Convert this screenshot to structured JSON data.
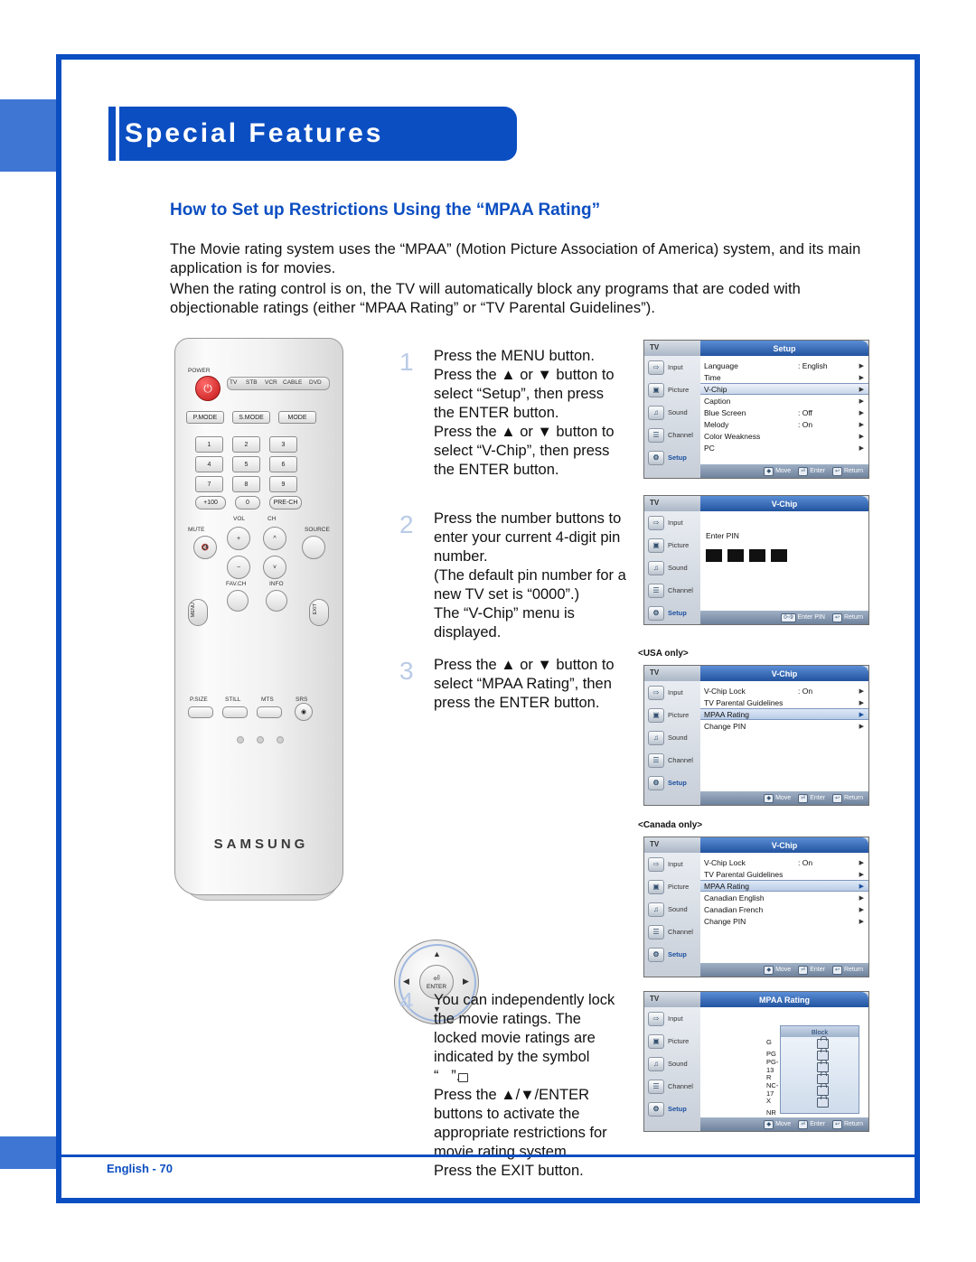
{
  "page": {
    "header_title": "Special Features",
    "section_title": "How to Set up Restrictions Using the “MPAA Rating”",
    "paragraph_1": "The Movie rating system uses the “MPAA” (Motion Picture Association of America) system, and its main application is for movies.",
    "paragraph_2": "When the rating control is on, the TV will automatically block any programs that are coded with objectionable ratings (either “MPAA Rating” or “TV Parental Guidelines”).",
    "footer": "English - 70"
  },
  "steps": [
    {
      "num": "1",
      "text": "Press the MENU button.\nPress the ▲ or ▼ button to select “Setup”, then press the ENTER button.\nPress the ▲ or ▼ button to select “V-Chip”, then press the ENTER button."
    },
    {
      "num": "2",
      "text": "Press the number buttons to enter your current 4-digit pin number.\n(The default pin number for a new TV set is “0000”.)\nThe “V-Chip” menu is displayed."
    },
    {
      "num": "3",
      "text": "Press the ▲ or ▼ button to select “MPAA Rating”, then press the ENTER button."
    },
    {
      "num": "4",
      "text": "You can independently lock the movie ratings. The locked movie ratings are indicated by the symbol\n“   ”.\nPress the ▲/▼/ENTER buttons to activate the appropriate restrictions for movie rating system.\nPress the EXIT button."
    }
  ],
  "remote": {
    "power_label": "POWER",
    "source_buttons": [
      "TV",
      "STB",
      "VCR",
      "CABLE",
      "DVD"
    ],
    "mode_row": [
      "P.MODE",
      "S.MODE",
      "MODE"
    ],
    "numbers": [
      "1",
      "2",
      "3",
      "4",
      "5",
      "6",
      "7",
      "8",
      "9"
    ],
    "num_row4": [
      "+100",
      "0",
      "PRE-CH"
    ],
    "vol_label": "VOL",
    "ch_label": "CH",
    "mute_label": "MUTE",
    "source_label": "SOURCE",
    "fav_label": "FAV.CH",
    "info_label": "INFO",
    "menu_label": "MENU",
    "exit_label": "EXIT",
    "enter_label": "ENTER",
    "bottom_row": [
      "P.SIZE",
      "STILL",
      "MTS",
      "SRS"
    ],
    "brand": "SAMSUNG"
  },
  "osd_common": {
    "tv_label": "TV",
    "side_items": [
      "Input",
      "Picture",
      "Sound",
      "Channel",
      "Setup"
    ],
    "footer": {
      "move": "Move",
      "enter": "Enter",
      "return": "Return"
    }
  },
  "osd_setup": {
    "title": "Setup",
    "rows": [
      {
        "label": "Language",
        "value": ": English",
        "chev": "▶",
        "selected": false
      },
      {
        "label": "Time",
        "value": "",
        "chev": "▶",
        "selected": false
      },
      {
        "label": "V-Chip",
        "value": "",
        "chev": "▶",
        "selected": true
      },
      {
        "label": "Caption",
        "value": "",
        "chev": "▶",
        "selected": false
      },
      {
        "label": "Blue Screen",
        "value": ": Off",
        "chev": "▶",
        "selected": false
      },
      {
        "label": "Melody",
        "value": ": On",
        "chev": "▶",
        "selected": false
      },
      {
        "label": "Color Weakness",
        "value": "",
        "chev": "▶",
        "selected": false
      },
      {
        "label": "PC",
        "value": "",
        "chev": "▶",
        "selected": false
      }
    ]
  },
  "osd_pin": {
    "title": "V-Chip",
    "prompt": "Enter PIN",
    "footer_enter": "Enter PIN",
    "footer_return": "Return",
    "digits": 4
  },
  "osd_usa": {
    "caption": "<USA only>",
    "title": "V-Chip",
    "rows": [
      {
        "label": "V-Chip Lock",
        "value": ": On",
        "chev": "▶",
        "selected": false
      },
      {
        "label": "TV Parental Guidelines",
        "value": "",
        "chev": "▶",
        "selected": false
      },
      {
        "label": "MPAA Rating",
        "value": "",
        "chev": "▶",
        "selected": true
      },
      {
        "label": "Change PIN",
        "value": "",
        "chev": "▶",
        "selected": false
      }
    ]
  },
  "osd_canada": {
    "caption": "<Canada only>",
    "title": "V-Chip",
    "rows": [
      {
        "label": "V-Chip Lock",
        "value": ": On",
        "chev": "▶",
        "selected": false
      },
      {
        "label": "TV Parental Guidelines",
        "value": "",
        "chev": "▶",
        "selected": false
      },
      {
        "label": "MPAA Rating",
        "value": "",
        "chev": "▶",
        "selected": true
      },
      {
        "label": "Canadian English",
        "value": "",
        "chev": "▶",
        "selected": false
      },
      {
        "label": "Canadian French",
        "value": "",
        "chev": "▶",
        "selected": false
      },
      {
        "label": "Change PIN",
        "value": "",
        "chev": "▶",
        "selected": false
      }
    ]
  },
  "osd_mpaa": {
    "title": "MPAA Rating",
    "block_header": "Block",
    "ratings": [
      "G",
      "PG",
      "PG-13",
      "R",
      "NC-17",
      "X",
      "NR"
    ]
  }
}
